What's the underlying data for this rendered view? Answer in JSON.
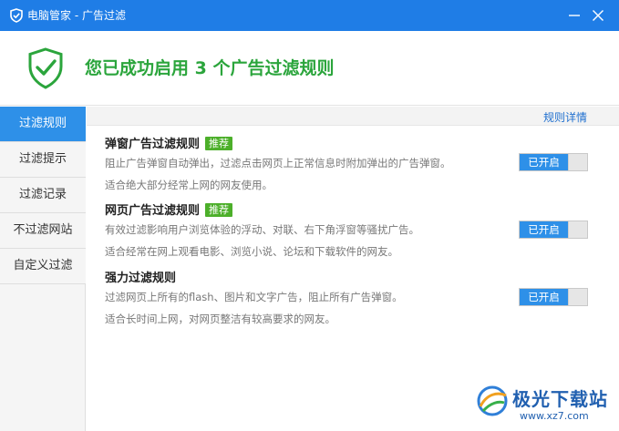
{
  "window": {
    "title": "电脑管家 - 广告过滤",
    "app_icon": "shield-check-icon",
    "minimize_icon": "minimize-icon",
    "close_icon": "close-icon",
    "accent": "#1f7de6"
  },
  "header": {
    "headline": "您已成功启用 3 个广告过滤规则",
    "icon": "shield-check-icon",
    "headline_color": "#2ba53c"
  },
  "sidebar": {
    "items": [
      {
        "label": "过滤规则",
        "active": true
      },
      {
        "label": "过滤提示",
        "active": false
      },
      {
        "label": "过滤记录",
        "active": false
      },
      {
        "label": "不过滤网站",
        "active": false
      },
      {
        "label": "自定义过滤",
        "active": false
      }
    ],
    "active_color": "#2e90e8"
  },
  "main": {
    "rules_link": "规则详情",
    "rules": [
      {
        "title": "弹窗广告过滤规则",
        "badge": "推荐",
        "desc": "阻止广告弹窗自动弹出，过滤点击网页上正常信息时附加弹出的广告弹窗。",
        "desc2": "适合绝大部分经常上网的网友使用。",
        "toggle": "已开启"
      },
      {
        "title": "网页广告过滤规则",
        "badge": "推荐",
        "desc": "有效过滤影响用户浏览体验的浮动、对联、右下角浮窗等骚扰广告。",
        "desc2": "适合经常在网上观看电影、浏览小说、论坛和下载软件的网友。",
        "toggle": "已开启"
      },
      {
        "title": "强力过滤规则",
        "badge": "",
        "desc": "过滤网页上所有的flash、图片和文字广告，阻止所有广告弹窗。",
        "desc2": "适合长时间上网，对网页整洁有较高要求的网友。",
        "toggle": "已开启"
      }
    ],
    "badge_color": "#4caf2a"
  },
  "watermark": {
    "brand": "极光下载站",
    "url": "www.xz7.com",
    "icon": "aurora-logo-icon"
  }
}
